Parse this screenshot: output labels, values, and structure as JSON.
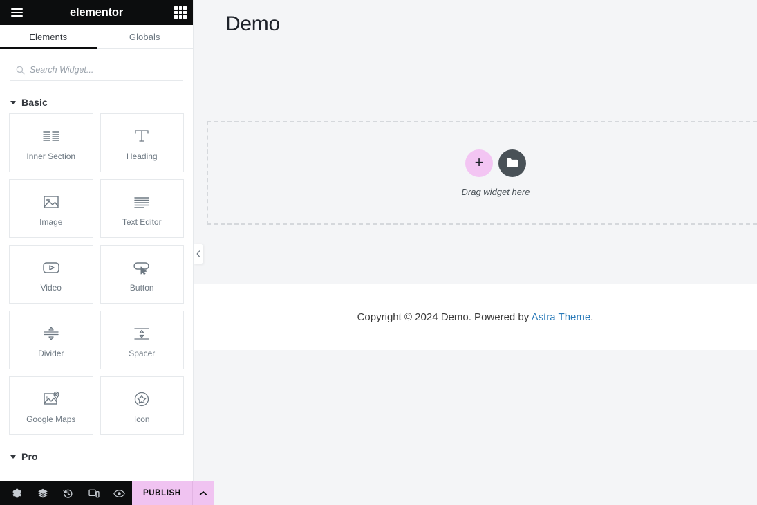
{
  "panel": {
    "logo": "elementor",
    "menu_icon": "hamburger-menu-icon",
    "apps_icon": "grid-apps-icon",
    "tabs": [
      {
        "label": "Elements",
        "active": true
      },
      {
        "label": "Globals",
        "active": false
      }
    ],
    "search": {
      "placeholder": "Search Widget...",
      "value": "",
      "icon": "search-icon"
    },
    "categories": [
      {
        "title": "Basic",
        "expanded": true,
        "widgets": [
          {
            "label": "Inner Section",
            "icon": "columns-icon"
          },
          {
            "label": "Heading",
            "icon": "heading-t-icon"
          },
          {
            "label": "Image",
            "icon": "image-icon"
          },
          {
            "label": "Text Editor",
            "icon": "text-lines-icon"
          },
          {
            "label": "Video",
            "icon": "video-play-icon"
          },
          {
            "label": "Button",
            "icon": "button-cursor-icon"
          },
          {
            "label": "Divider",
            "icon": "divider-icon"
          },
          {
            "label": "Spacer",
            "icon": "spacer-icon"
          },
          {
            "label": "Google Maps",
            "icon": "map-pin-icon"
          },
          {
            "label": "Icon",
            "icon": "star-circle-icon"
          }
        ]
      },
      {
        "title": "Pro",
        "expanded": true,
        "widgets": []
      }
    ],
    "footer": {
      "tools": [
        {
          "name": "settings-gear-icon",
          "title": "Settings"
        },
        {
          "name": "layers-navigator-icon",
          "title": "Navigator"
        },
        {
          "name": "history-clock-icon",
          "title": "History"
        },
        {
          "name": "responsive-device-icon",
          "title": "Responsive Mode"
        },
        {
          "name": "eye-preview-icon",
          "title": "Preview Changes"
        }
      ],
      "publish_label": "PUBLISH",
      "publish_caret_icon": "chevron-up-icon",
      "publish_color": "#f0c3f1"
    }
  },
  "canvas": {
    "collapse_handle_icon": "chevron-left-icon",
    "site_title": "Demo",
    "dropzone": {
      "add_icon": "plus-icon",
      "folder_icon": "folder-icon",
      "caption": "Drag widget here",
      "add_color": "#f3c5f3",
      "folder_color": "#495157"
    },
    "footer": {
      "prefix": "Copyright © 2024 Demo. Powered by ",
      "link": "Astra Theme",
      "suffix": ".",
      "link_color": "#2a7ab9"
    }
  }
}
